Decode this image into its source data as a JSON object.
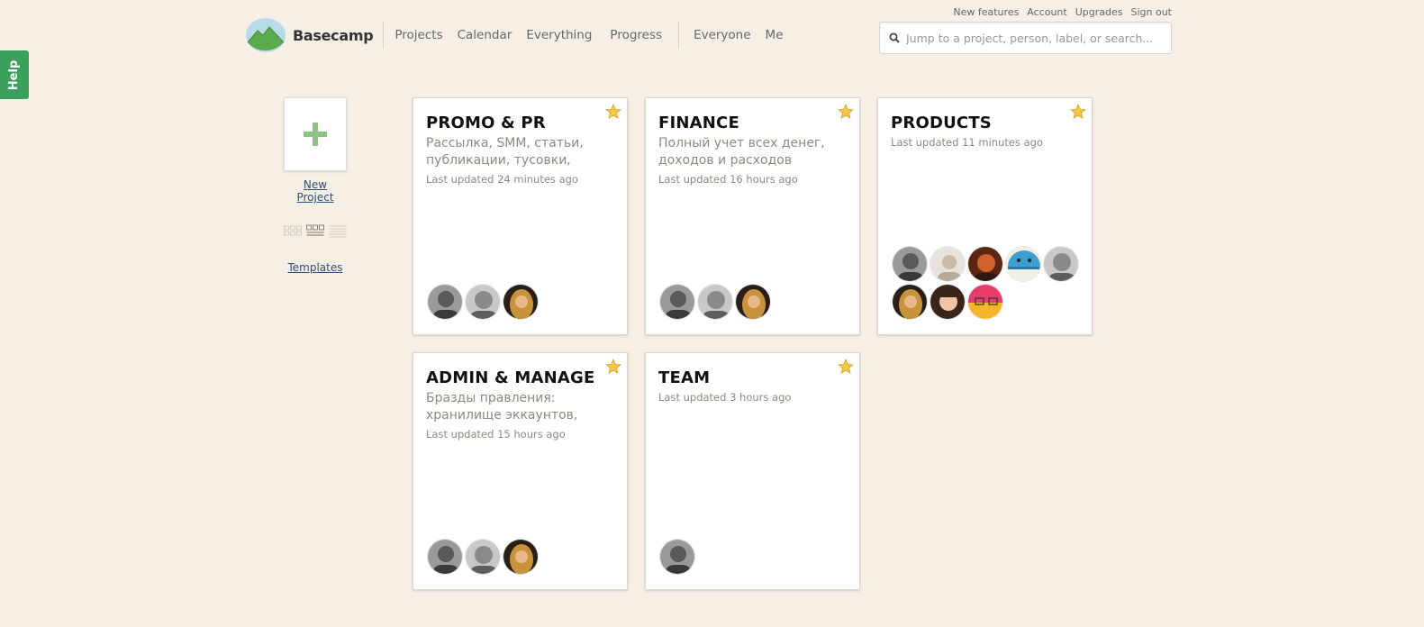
{
  "help": {
    "label": "Help"
  },
  "top_links": [
    "New features",
    "Account",
    "Upgrades",
    "Sign out"
  ],
  "logo": {
    "text": "Basecamp"
  },
  "nav": {
    "items": [
      "Projects",
      "Calendar",
      "Everything",
      "Progress"
    ],
    "people": [
      "Everyone",
      "Me"
    ],
    "active": "Projects"
  },
  "search": {
    "placeholder": "Jump to a project, person, label, or search...",
    "value": ""
  },
  "sidebar": {
    "new_project": "New Project",
    "templates": "Templates"
  },
  "projects": [
    {
      "title": "PROMO & PR",
      "description": "Рассылка, SMM, статьи, публикации, тусовки,",
      "updated": "Last updated 24 minutes ago",
      "avatars": [
        "man-beard-gray",
        "man-blonde-gray",
        "woman-dark"
      ]
    },
    {
      "title": "FINANCE",
      "description": "Полный учет всех денег, доходов и расходов",
      "updated": "Last updated 16 hours ago",
      "avatars": [
        "man-beard-gray",
        "man-blonde-gray",
        "woman-dark"
      ]
    },
    {
      "title": "PRODUCTS",
      "description": "",
      "updated": "Last updated 11 minutes ago",
      "avatars": [
        "man-beard-gray",
        "man-light-photo",
        "man-red-photo",
        "blue-creature",
        "man-blonde-gray",
        "woman-dark",
        "woman-smiling",
        "pink-yellow-mask"
      ]
    },
    {
      "title": "ADMIN & MANAGE",
      "description": "Бразды правления: хранилище эккаунтов,",
      "updated": "Last updated 15 hours ago",
      "avatars": [
        "man-beard-gray",
        "man-blonde-gray",
        "woman-dark"
      ]
    },
    {
      "title": "TEAM",
      "description": "",
      "updated": "Last updated 3 hours ago",
      "avatars": [
        "man-beard-gray"
      ]
    }
  ],
  "colors": {
    "background": "#f5efe6",
    "help_green": "#3aa05b",
    "link_blue": "#2e5077",
    "star_gold": "#f5c842"
  }
}
